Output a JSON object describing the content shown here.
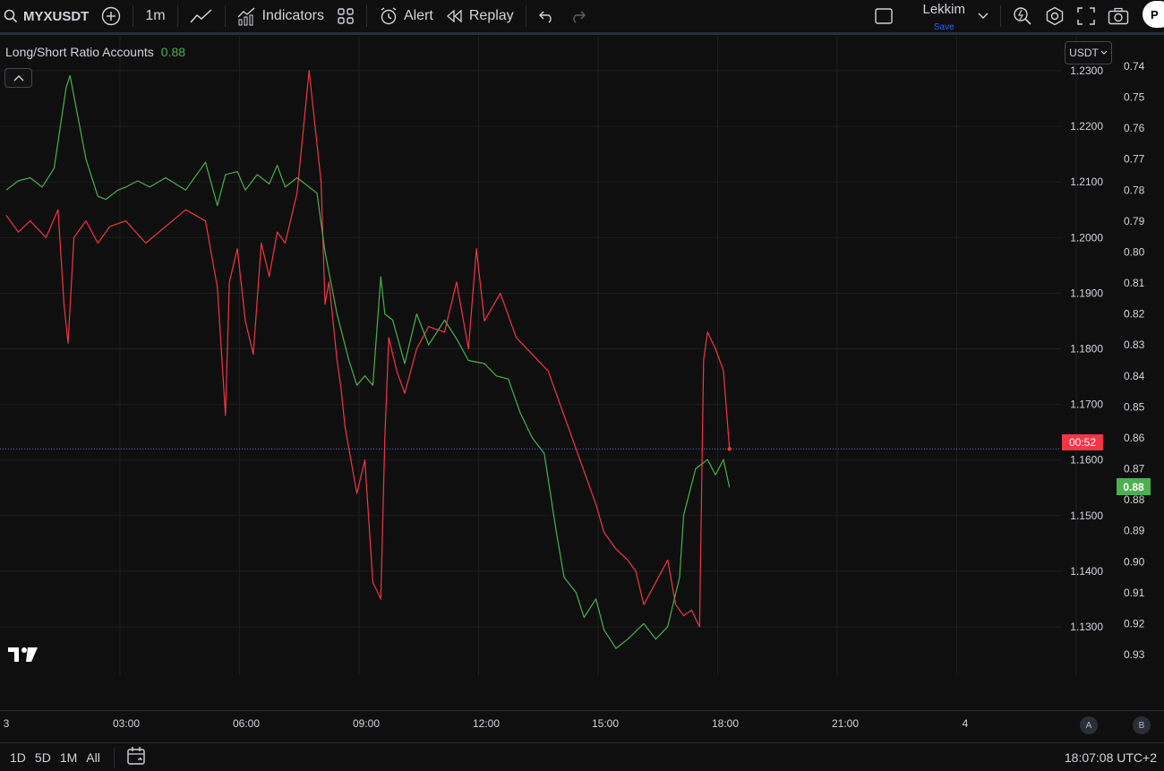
{
  "toolbar": {
    "symbol": "MYXUSDT",
    "interval": "1m",
    "indicators_label": "Indicators",
    "alert_label": "Alert",
    "replay_label": "Replay",
    "layout_name": "Lekkim",
    "layout_save": "Save",
    "publish_label": "P"
  },
  "legend": {
    "name": "Long/Short Ratio Accounts",
    "value": "0.88"
  },
  "currency": "USDT",
  "price_tags": {
    "countdown": "00:52",
    "ratio": "0.88"
  },
  "time_axis": [
    "3",
    "03:00",
    "06:00",
    "09:00",
    "12:00",
    "15:00",
    "18:00",
    "21:00",
    "4"
  ],
  "scale_buttons": [
    "A",
    "B"
  ],
  "bottom": {
    "ranges": [
      "1D",
      "5D",
      "1M",
      "All"
    ],
    "clock": "18:07:08 UTC+2"
  },
  "colors": {
    "price_line": "#f23645",
    "ratio_line": "#4caf50",
    "background": "#0f0f0f",
    "grid": "#1f1f1f"
  },
  "chart_data": {
    "type": "line",
    "price_axis": {
      "ticks": [
        "1.2300",
        "1.2200",
        "1.2100",
        "1.2000",
        "1.1900",
        "1.1800",
        "1.1700",
        "1.1600",
        "1.1500",
        "1.1400",
        "1.1300"
      ],
      "range": [
        1.1255,
        1.2315
      ]
    },
    "ratio_axis": {
      "ticks": [
        "0.74",
        "0.75",
        "0.76",
        "0.77",
        "0.78",
        "0.79",
        "0.80",
        "0.81",
        "0.82",
        "0.83",
        "0.84",
        "0.85",
        "0.86",
        "0.87",
        "0.88",
        "0.89",
        "0.90",
        "0.91",
        "0.92",
        "0.93"
      ],
      "inverted": true
    },
    "x_range_hours": [
      0,
      27
    ],
    "series": [
      {
        "color": "#f23645",
        "x_hours": [
          0,
          0.3,
          0.6,
          1.0,
          1.3,
          1.45,
          1.55,
          1.7,
          2.0,
          2.3,
          2.6,
          3.0,
          3.5,
          4.0,
          4.5,
          5.0,
          5.3,
          5.5,
          5.6,
          5.8,
          6.0,
          6.2,
          6.4,
          6.6,
          6.8,
          7.0,
          7.3,
          7.6,
          7.9,
          8.0,
          8.1,
          8.3,
          8.4,
          8.5,
          8.6,
          8.8,
          9.0,
          9.2,
          9.4,
          9.5,
          9.6,
          9.8,
          10.0,
          10.3,
          10.6,
          11.0,
          11.3,
          11.6,
          11.8,
          12.0,
          12.4,
          12.8,
          13.2,
          13.6,
          14.0,
          14.4,
          14.8,
          15.0,
          15.3,
          15.6,
          15.8,
          16.0,
          16.3,
          16.6,
          16.8,
          17.0,
          17.2,
          17.4,
          17.5,
          17.6,
          17.8,
          18.0,
          18.15
        ],
        "values": [
          1.204,
          1.201,
          1.203,
          1.2,
          1.205,
          1.188,
          1.181,
          1.2,
          1.203,
          1.199,
          1.202,
          1.203,
          1.199,
          1.202,
          1.205,
          1.203,
          1.191,
          1.168,
          1.192,
          1.198,
          1.185,
          1.179,
          1.199,
          1.193,
          1.201,
          1.199,
          1.208,
          1.23,
          1.21,
          1.188,
          1.192,
          1.178,
          1.173,
          1.166,
          1.162,
          1.154,
          1.16,
          1.138,
          1.135,
          1.164,
          1.182,
          1.176,
          1.172,
          1.18,
          1.184,
          1.183,
          1.192,
          1.18,
          1.198,
          1.185,
          1.19,
          1.182,
          1.179,
          1.176,
          1.168,
          1.16,
          1.152,
          1.147,
          1.144,
          1.142,
          1.14,
          1.134,
          1.138,
          1.142,
          1.134,
          1.132,
          1.133,
          1.13,
          1.178,
          1.183,
          1.18,
          1.176,
          1.162
        ]
      },
      {
        "color": "#4caf50",
        "x_hours": [
          0,
          0.3,
          0.6,
          0.9,
          1.2,
          1.5,
          1.6,
          2.0,
          2.3,
          2.5,
          2.8,
          3.0,
          3.3,
          3.6,
          4.0,
          4.5,
          5.0,
          5.3,
          5.5,
          5.8,
          6.0,
          6.3,
          6.6,
          6.8,
          7.0,
          7.3,
          7.5,
          7.8,
          8.0,
          8.3,
          8.6,
          8.8,
          9.0,
          9.2,
          9.4,
          9.5,
          9.7,
          10.0,
          10.3,
          10.6,
          11.0,
          11.3,
          11.6,
          12.0,
          12.3,
          12.6,
          12.9,
          13.2,
          13.5,
          13.8,
          14.0,
          14.3,
          14.5,
          14.8,
          15.0,
          15.3,
          15.6,
          16.0,
          16.3,
          16.6,
          16.9,
          17.0,
          17.3,
          17.4,
          17.6,
          17.8,
          18.0,
          18.15
        ],
        "values": [
          0.78,
          0.777,
          0.776,
          0.779,
          0.773,
          0.747,
          0.743,
          0.77,
          0.782,
          0.783,
          0.78,
          0.779,
          0.777,
          0.779,
          0.776,
          0.78,
          0.771,
          0.785,
          0.775,
          0.774,
          0.78,
          0.775,
          0.778,
          0.772,
          0.779,
          0.776,
          0.778,
          0.781,
          0.8,
          0.82,
          0.835,
          0.843,
          0.84,
          0.843,
          0.808,
          0.82,
          0.822,
          0.836,
          0.82,
          0.83,
          0.822,
          0.828,
          0.835,
          0.836,
          0.84,
          0.841,
          0.852,
          0.86,
          0.865,
          0.89,
          0.905,
          0.91,
          0.918,
          0.912,
          0.922,
          0.928,
          0.925,
          0.92,
          0.925,
          0.921,
          0.905,
          0.885,
          0.87,
          0.869,
          0.867,
          0.872,
          0.867,
          0.876
        ]
      }
    ]
  }
}
